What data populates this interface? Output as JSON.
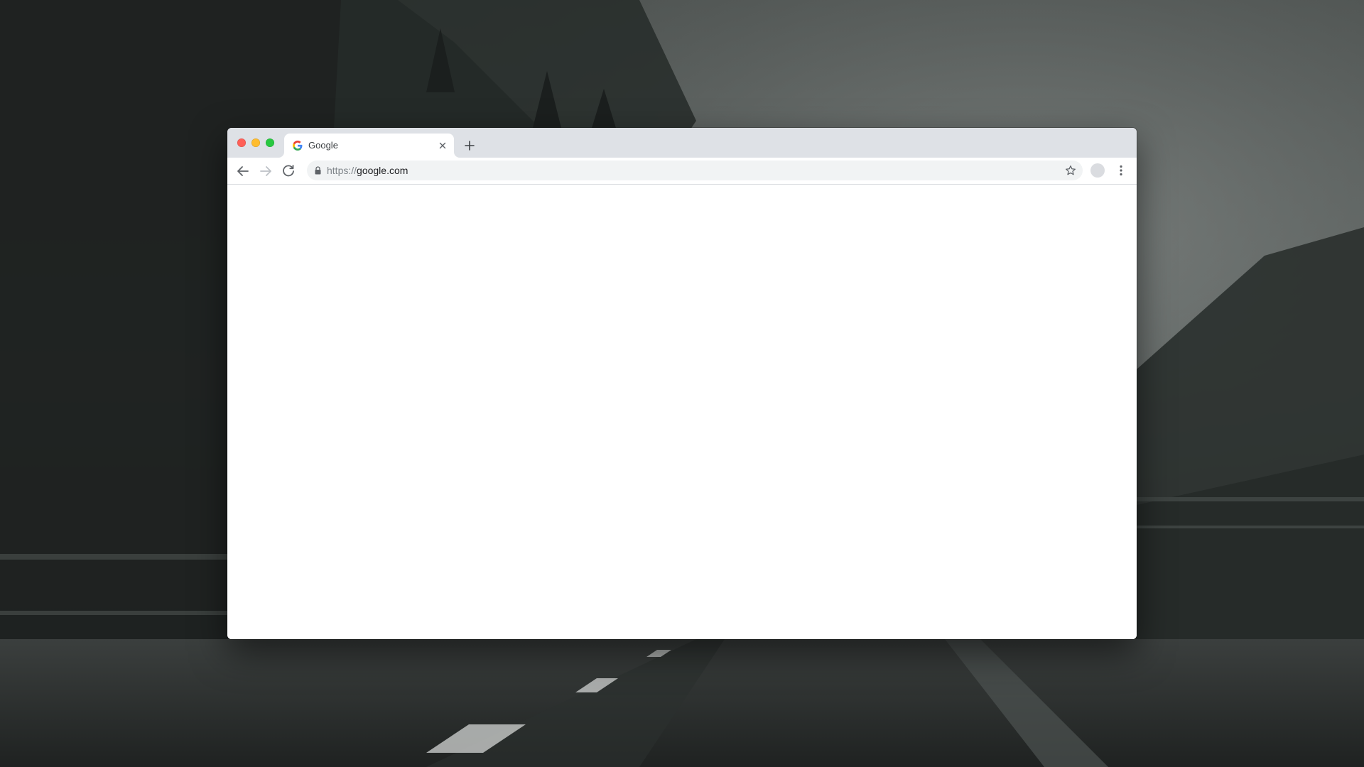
{
  "window": {
    "traffic_lights": {
      "close_color": "#ff5f57",
      "minimize_color": "#febc2e",
      "zoom_color": "#28c840"
    }
  },
  "tabs": [
    {
      "title": "Google",
      "favicon": "google-g-icon",
      "active": true
    }
  ],
  "toolbar": {
    "back_icon": "arrow-left-icon",
    "forward_icon": "arrow-right-icon",
    "reload_icon": "reload-icon",
    "url_scheme": "https://",
    "url_host": "google.com",
    "secure_icon": "lock-icon",
    "bookmark_icon": "star-outline-icon",
    "profile_icon": "avatar",
    "menu_icon": "kebab-menu-icon"
  },
  "colors": {
    "tab_strip": "#dee1e6",
    "omnibox": "#f1f3f4",
    "accent_blue": "#4285f4"
  }
}
